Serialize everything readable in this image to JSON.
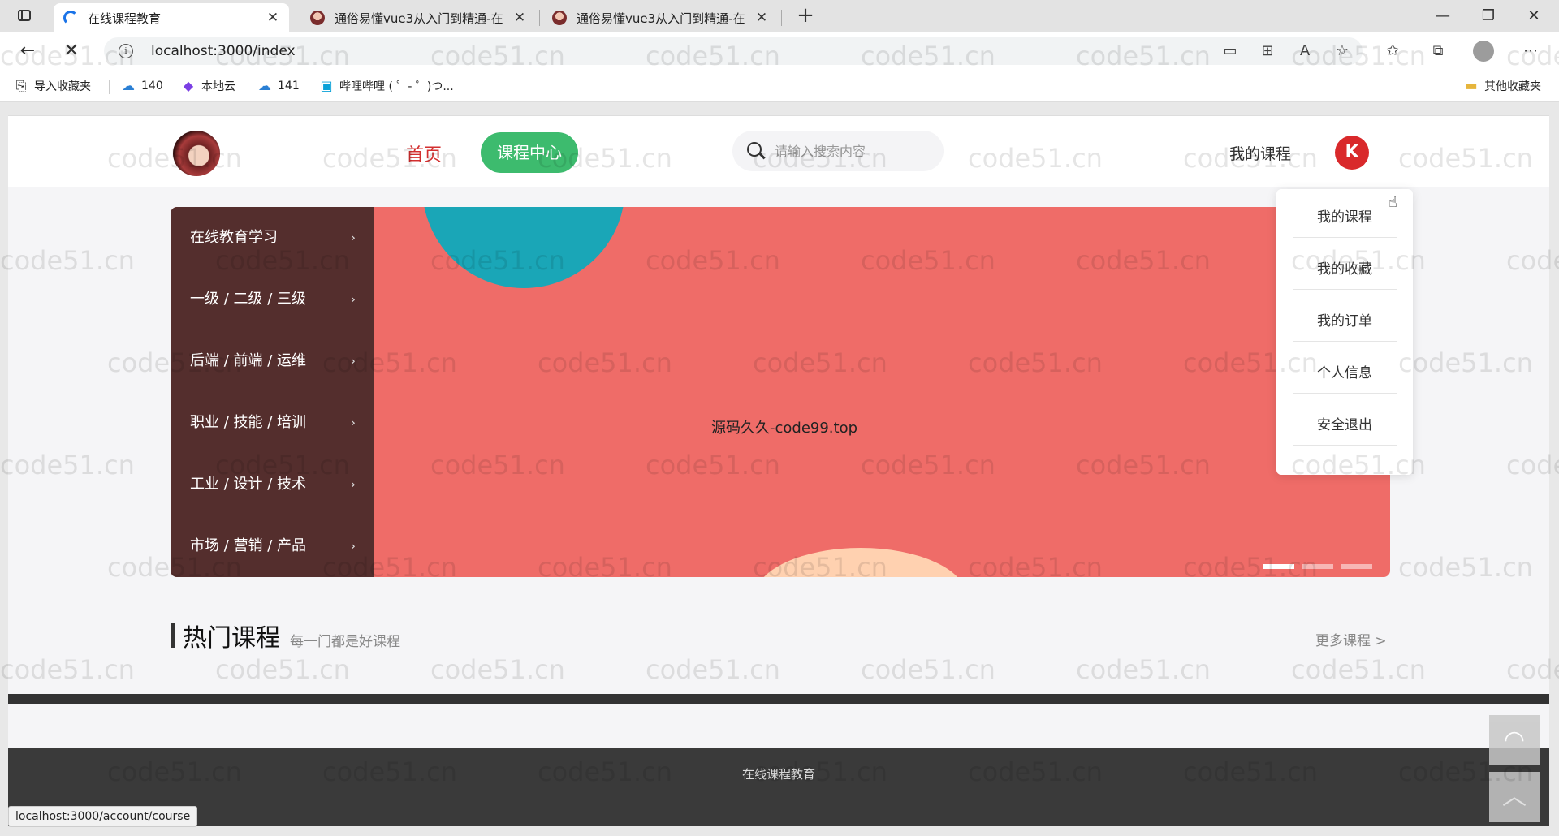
{
  "browser": {
    "tabs": [
      {
        "title": "在线课程教育",
        "active": true
      },
      {
        "title": "通俗易懂vue3从入门到精通-在",
        "active": false
      },
      {
        "title": "通俗易懂vue3从入门到精通-在",
        "active": false
      }
    ],
    "url": "localhost:3000/index",
    "favorites": [
      {
        "label": "导入收藏夹",
        "icon": "import-icon"
      },
      {
        "label": "140",
        "icon": "cloud-icon"
      },
      {
        "label": "本地云",
        "icon": "obsidian-icon"
      },
      {
        "label": "141",
        "icon": "cloud-icon"
      },
      {
        "label": "哔哩哔哩 ( ゜- ゜)つ...",
        "icon": "bilibili-icon"
      }
    ],
    "other_favorites": "其他收藏夹",
    "status_url": "localhost:3000/account/course"
  },
  "header": {
    "nav_home": "首页",
    "nav_center": "课程中心",
    "search_placeholder": "请输入搜索内容",
    "my_course": "我的课程"
  },
  "banner": {
    "text": "源码久久-code99.top",
    "categories": [
      "在线教育学习",
      "一级 / 二级 / 三级",
      "后端 / 前端 / 运维",
      "职业 / 技能 / 培训",
      "工业 / 设计 / 技术",
      "市场 / 营销 / 产品"
    ],
    "slide_count": 3,
    "active_slide": 1
  },
  "hot": {
    "title": "热门课程",
    "subtitle": "每一门都是好课程",
    "more": "更多课程 >"
  },
  "footer": {
    "text": "在线课程教育"
  },
  "dropdown": {
    "items": [
      "我的课程",
      "我的收藏",
      "我的订单",
      "个人信息",
      "安全退出"
    ]
  },
  "watermark": "code51.cn",
  "colors": {
    "brand_green": "#3dbb6e",
    "home_red": "#d32f2f",
    "banner_bg": "#ef6c68",
    "menu_bg": "#281c1c",
    "footer_bg": "#3a3a3a"
  }
}
